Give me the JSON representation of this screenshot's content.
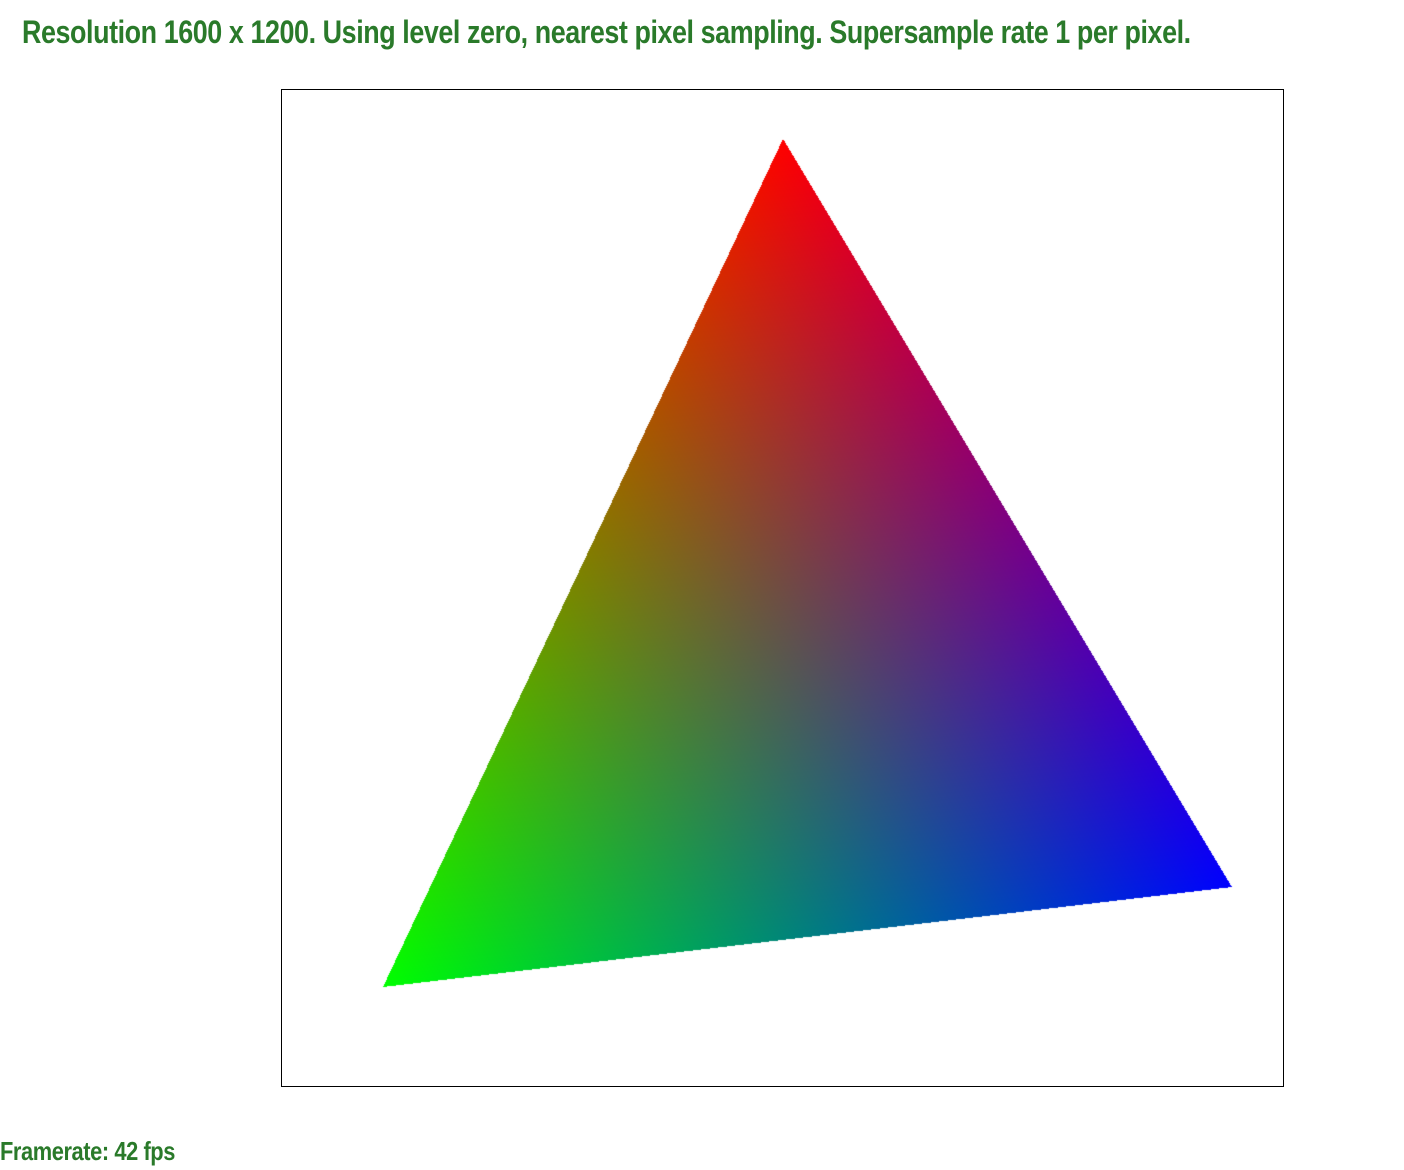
{
  "info": {
    "text": "Resolution 1600 x 1200. Using level zero, nearest pixel sampling. Supersample rate 1 per pixel."
  },
  "framerate": {
    "text": "Framerate: 42 fps"
  },
  "triangle": {
    "vertex_colors": [
      "#ff0000",
      "#0000ff",
      "#00ff00"
    ]
  },
  "colors": {
    "status_text": "#2a7a2a",
    "viewport_border": "#000000",
    "background": "#ffffff"
  }
}
